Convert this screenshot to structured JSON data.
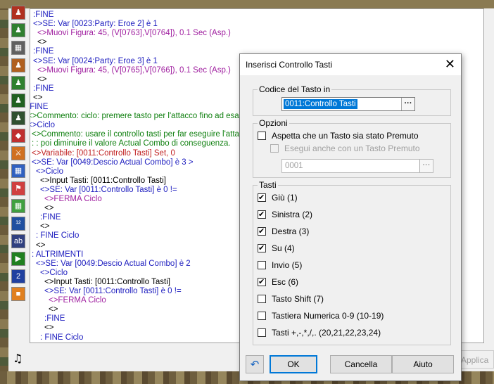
{
  "event_list": {
    "lines": [
      {
        "text": ":FINE",
        "color": "blue",
        "indent": 14
      },
      {
        "text": "<>SE: Var [0023:Party: Eroe 2] è 1",
        "color": "blue",
        "indent": 14
      },
      {
        "text": "<>Muovi Figura: 45, (V[0763],V[0764]), 0.1 Sec (Asp.)",
        "color": "purple",
        "indent": 20
      },
      {
        "text": "<>",
        "color": "black",
        "indent": 20
      },
      {
        "text": ":FINE",
        "color": "blue",
        "indent": 14
      },
      {
        "text": "<>SE: Var [0024:Party: Eroe 3] è 1",
        "color": "blue",
        "indent": 14
      },
      {
        "text": "<>Muovi Figura: 45, (V[0765],V[0766]), 0.1 Sec (Asp.)",
        "color": "purple",
        "indent": 20
      },
      {
        "text": "<>",
        "color": "black",
        "indent": 20
      },
      {
        "text": ":FINE",
        "color": "blue",
        "indent": 14
      },
      {
        "text": "<>",
        "color": "black",
        "indent": 14
      },
      {
        "text": ":FINE",
        "color": "blue",
        "indent": 6
      },
      {
        "text": "<>Commento: ciclo: premere tasto per l'attacco fino ad esaurimento",
        "color": "green",
        "indent": 6
      },
      {
        "text": "<>Ciclo",
        "color": "blue",
        "indent": 6
      },
      {
        "text": "<>Commento: usare il controllo tasti per far eseguire l'attacco",
        "color": "green",
        "indent": 12
      },
      {
        "text": ":     : poi diminuire il valore Actual Combo di conseguenza.",
        "color": "green",
        "indent": 12
      },
      {
        "text": "<>Variabile: [0011:Controllo Tasti] Set, 0",
        "color": "red",
        "indent": 12
      },
      {
        "text": "<>SE: Var [0049:Descio Actual Combo] è 3 >",
        "color": "blue",
        "indent": 12
      },
      {
        "text": "<>Ciclo",
        "color": "blue",
        "indent": 18
      },
      {
        "text": "<>Input Tasti: [0011:Controllo Tasti]",
        "color": "black",
        "indent": 24
      },
      {
        "text": "<>SE: Var [0011:Controllo Tasti] è 0 !=",
        "color": "blue",
        "indent": 24
      },
      {
        "text": "<>FERMA Ciclo",
        "color": "purple",
        "indent": 30
      },
      {
        "text": "<>",
        "color": "black",
        "indent": 30
      },
      {
        "text": ":FINE",
        "color": "blue",
        "indent": 24
      },
      {
        "text": "<>",
        "color": "black",
        "indent": 24
      },
      {
        "text": ": FINE Ciclo",
        "color": "blue",
        "indent": 18
      },
      {
        "text": "<>",
        "color": "black",
        "indent": 18
      },
      {
        "text": ": ALTRIMENTI",
        "color": "blue",
        "indent": 12
      },
      {
        "text": "<>SE: Var [0049:Descio Actual Combo] è 2",
        "color": "blue",
        "indent": 18
      },
      {
        "text": "<>Ciclo",
        "color": "blue",
        "indent": 24
      },
      {
        "text": "<>Input Tasti: [0011:Controllo Tasti]",
        "color": "black",
        "indent": 30
      },
      {
        "text": "<>SE: Var [0011:Controllo Tasti] è 0 !=",
        "color": "blue",
        "indent": 30
      },
      {
        "text": "<>FERMA Ciclo",
        "color": "purple",
        "indent": 36
      },
      {
        "text": "<>",
        "color": "black",
        "indent": 36
      },
      {
        "text": ":FINE",
        "color": "blue",
        "indent": 30
      },
      {
        "text": "<>",
        "color": "black",
        "indent": 30
      },
      {
        "text": ": FINE Ciclo",
        "color": "blue",
        "indent": 24
      }
    ]
  },
  "toolbar": {
    "buttons": [
      {
        "icon": "character-icon",
        "color": "#b03020",
        "glyph": "♟"
      },
      {
        "icon": "character-icon",
        "color": "#308030",
        "glyph": "♟"
      },
      {
        "icon": "map-icon",
        "color": "#606060",
        "glyph": "▦"
      },
      {
        "icon": "character-icon",
        "color": "#b06020",
        "glyph": "♟"
      },
      {
        "icon": "character-icon",
        "color": "#308030",
        "glyph": "♟"
      },
      {
        "icon": "character-icon",
        "color": "#206020",
        "glyph": "♟"
      },
      {
        "icon": "character-icon",
        "color": "#305030",
        "glyph": "♟"
      },
      {
        "icon": "item-icon",
        "color": "#c03030",
        "glyph": "◆"
      },
      {
        "icon": "battle-icon",
        "color": "#d07020",
        "glyph": "⚔"
      },
      {
        "icon": "map-icon",
        "color": "#3060c0",
        "glyph": "▦"
      },
      {
        "icon": "flag-icon",
        "color": "#d04040",
        "glyph": "⚑"
      },
      {
        "icon": "grid-icon",
        "color": "#40a040",
        "glyph": "▦"
      },
      {
        "icon": "numbers-icon",
        "color": "#2050a0",
        "glyph": "¹²"
      },
      {
        "icon": "text-icon",
        "color": "#304080",
        "glyph": "ab"
      },
      {
        "icon": "play-icon",
        "color": "#208020",
        "glyph": "▶"
      },
      {
        "icon": "page-2-icon",
        "color": "#2040a0",
        "glyph": "2"
      },
      {
        "icon": "box-icon",
        "color": "#e08020",
        "glyph": "■"
      }
    ]
  },
  "apply_button": {
    "label": "Applica"
  },
  "dialog": {
    "title": "Inserisci Controllo Tasti",
    "key_code_group": {
      "label": "Codice del Tasto in",
      "value": "0011:Controllo Tasti"
    },
    "options_group": {
      "label": "Opzioni",
      "wait_label": "Aspetta che un Tasto sia stato Premuto",
      "also_label": "Esegui anche con un Tasto Premuto",
      "also_value": "0001"
    },
    "keys_group": {
      "label": "Tasti",
      "items": [
        {
          "label": "Giù (1)",
          "checked": true
        },
        {
          "label": "Sinistra (2)",
          "checked": true
        },
        {
          "label": "Destra (3)",
          "checked": true
        },
        {
          "label": "Su (4)",
          "checked": true
        },
        {
          "label": "Invio (5)",
          "checked": false
        },
        {
          "label": "Esc (6)",
          "checked": true
        },
        {
          "label": "Tasto Shift (7)",
          "checked": false
        },
        {
          "label": "Tastiera Numerica 0-9 (10-19)",
          "checked": false
        },
        {
          "label": "Tasti +,-,*,/,. (20,21,22,23,24)",
          "checked": false
        }
      ]
    },
    "buttons": {
      "ok": "OK",
      "cancel": "Cancella",
      "help": "Aiuto"
    }
  },
  "colors": {
    "blue": "#2020c0",
    "purple": "#a020a0",
    "green": "#108010",
    "red": "#c02020",
    "black": "#000000",
    "selection": "#0078d7"
  }
}
